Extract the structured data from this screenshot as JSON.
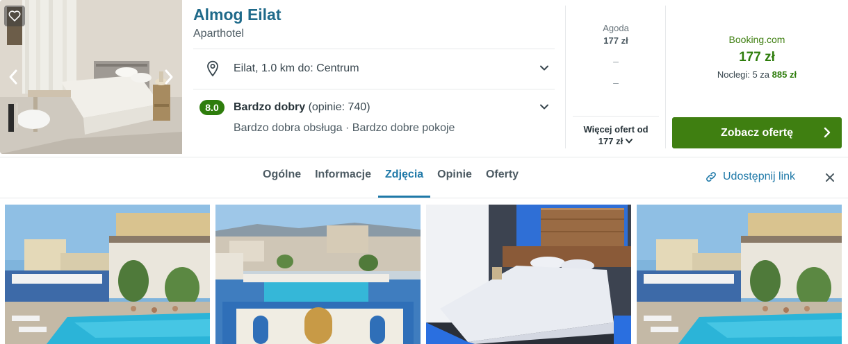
{
  "hotel": {
    "name": "Almog Eilat",
    "type": "Aparthotel",
    "location": "Eilat, 1.0 km do: Centrum",
    "rating": {
      "score": "8.0",
      "label": "Bardzo dobry",
      "reviews": "(opinie: 740)",
      "highlights": "Bardzo dobra obsługa · Bardzo dobre pokoje"
    },
    "hero_gallery": {
      "favorite_icon": "heart-icon",
      "prev_icon": "chevron-left-icon",
      "next_icon": "chevron-right-icon"
    }
  },
  "alternative_offers": {
    "site": "Agoda",
    "price": "177 zł",
    "dash_1": "–",
    "dash_2": "–",
    "more_label": "Więcej ofert od",
    "more_price": "177 zł"
  },
  "best_offer": {
    "site": "Booking.com",
    "price": "177 zł",
    "nights_prefix": "Noclegi: 5 za",
    "nights_total": "885 zł",
    "cta_label": "Zobacz ofertę"
  },
  "tabs": [
    {
      "label": "Ogólne",
      "active": false
    },
    {
      "label": "Informacje",
      "active": false
    },
    {
      "label": "Zdjęcia",
      "active": true
    },
    {
      "label": "Opinie",
      "active": false
    },
    {
      "label": "Oferty",
      "active": false
    }
  ],
  "share": {
    "label": "Udostępnij link",
    "icon": "link-icon"
  },
  "close_icon": "close-icon",
  "colors": {
    "accent_blue": "#1f79a8",
    "title_blue": "#1f6a8a",
    "deal_green": "#3f7f11",
    "rating_green": "#2e7d0c"
  }
}
